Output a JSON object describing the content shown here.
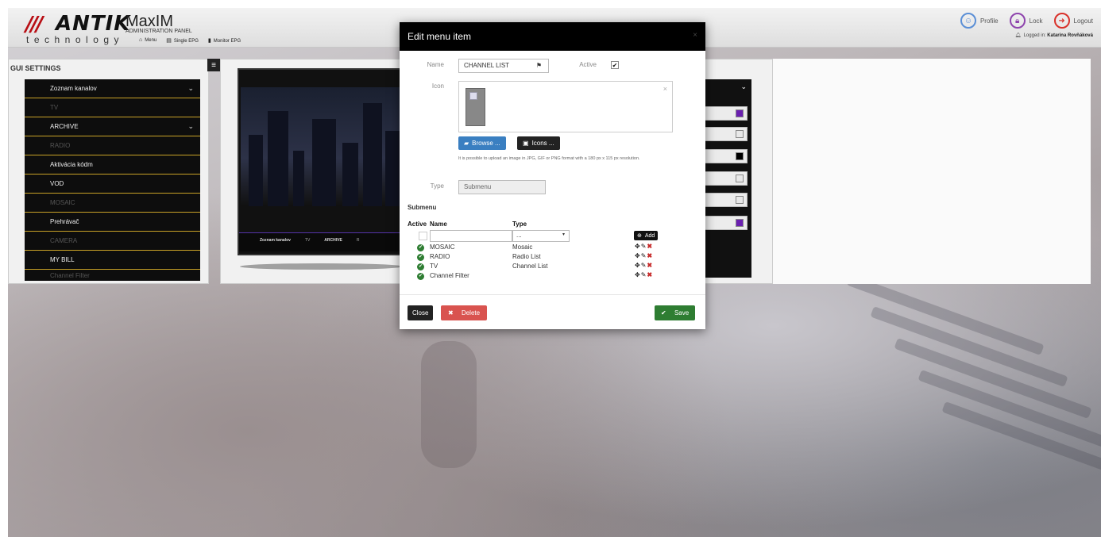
{
  "header": {
    "logo_stripes": "///",
    "logo_name": "ANTIK",
    "logo_tech": "technology",
    "product": "MaxIM",
    "product_sub": "ADMINISTRATION PANEL",
    "nav": [
      {
        "label": "Menu",
        "icon": "home-icon"
      },
      {
        "label": "Single EPG",
        "icon": "calendar-icon"
      },
      {
        "label": "Monitor EPG",
        "icon": "bar-chart-icon"
      }
    ],
    "profile": "Profile",
    "lock": "Lock",
    "logout": "Logout",
    "logged_in_label": "Logged in:",
    "logged_in_user": "Katarina Rovňáková",
    "colors": {
      "profile": "#5b8fd6",
      "lock": "#8e44ad",
      "logout": "#d9312a"
    }
  },
  "gui_settings": {
    "title": "GUI SETTINGS",
    "items": [
      {
        "label": "Zoznam kanalov",
        "dim": false,
        "chevron": true
      },
      {
        "label": "TV",
        "dim": true,
        "chevron": false
      },
      {
        "label": "ARCHIVE",
        "dim": false,
        "chevron": true
      },
      {
        "label": "RADIO",
        "dim": true,
        "chevron": false
      },
      {
        "label": "Aktivácia kódm",
        "dim": false,
        "chevron": false
      },
      {
        "label": "VOD",
        "dim": false,
        "chevron": false
      },
      {
        "label": "MOSAIC",
        "dim": true,
        "chevron": false
      },
      {
        "label": "Prehrávač",
        "dim": false,
        "chevron": false
      },
      {
        "label": "CAMERA",
        "dim": true,
        "chevron": false
      },
      {
        "label": "MY BILL",
        "dim": false,
        "chevron": false
      },
      {
        "label": "Channel Filter",
        "dim": true,
        "chevron": false
      }
    ]
  },
  "preview": {
    "menu": [
      "Zoznam kanalov",
      "TV",
      "ARCHIVE",
      "R"
    ],
    "swatch_colors": [
      "#6a1fb0",
      "#e8e8e8",
      "#000000",
      "#e8e8e8",
      "#e8e8e8",
      "#6a1fb0"
    ]
  },
  "modal": {
    "title": "Edit menu item",
    "close_x": "×",
    "name_label": "Name",
    "name_value": "CHANNEL LIST",
    "active_label": "Active",
    "icon_label": "Icon",
    "browse": "Browse ...",
    "icons": "Icons ...",
    "hint": "It is possible to upload an image in JPG, GIF or PNG format with a 180 px x 115 px resolution.",
    "type_label": "Type",
    "type_value": "Submenu",
    "submenu_title": "Submenu",
    "col_active": "Active",
    "col_name": "Name",
    "col_type": "Type",
    "new_type_placeholder": "...",
    "add": "Add",
    "rows": [
      {
        "name": "MOSAIC",
        "type": "Mosaic"
      },
      {
        "name": "RADIO",
        "type": "Radio List"
      },
      {
        "name": "TV",
        "type": "Channel List"
      },
      {
        "name": "Channel Filter",
        "type": ""
      }
    ],
    "close": "Close",
    "delete": "Delete",
    "save": "Save",
    "colors": {
      "browse": "#3a7fc1",
      "delete": "#d9534f",
      "save": "#2e7d32",
      "close": "#222222"
    }
  }
}
